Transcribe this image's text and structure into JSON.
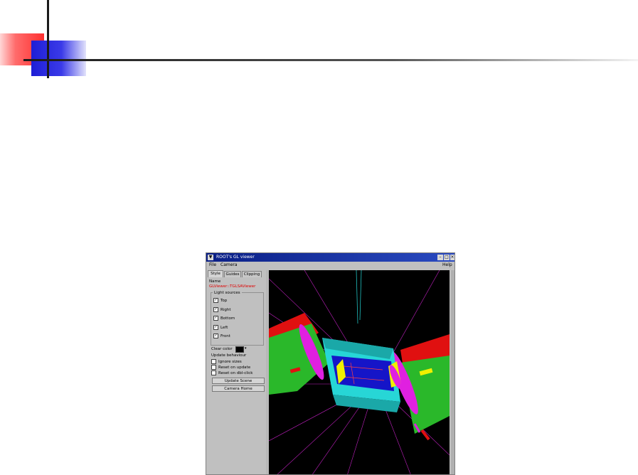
{
  "window": {
    "title": "ROOT's GL viewer",
    "menu": [
      "File",
      "Camera",
      "Help"
    ]
  },
  "panel": {
    "tabs": [
      "Style",
      "Guides",
      "Clipping"
    ],
    "name_label": "Name",
    "name_value": "GLViewer::TGLSAViewer",
    "light_sources_title": "Light sources",
    "lights": [
      {
        "label": "Top",
        "checked": true
      },
      {
        "label": "Right",
        "checked": true
      },
      {
        "label": "Bottom",
        "checked": true
      },
      {
        "label": "Left",
        "checked": true
      },
      {
        "label": "Front",
        "checked": true
      }
    ],
    "clear_color_label": "Clear color",
    "update_title": "Update behaviour",
    "update_options": [
      {
        "label": "Ignore sizes",
        "checked": false
      },
      {
        "label": "Reset on update",
        "checked": false
      },
      {
        "label": "Reset on dbl-click",
        "checked": false
      }
    ],
    "buttons": [
      "Update Scene",
      "Camera Home"
    ]
  },
  "colors": {
    "background": "#000000",
    "name_value": "#e00000",
    "detector_red": "#e01010",
    "detector_green": "#2ab82a",
    "detector_cyan": "#27d6d6",
    "detector_blue": "#1515c8",
    "detector_magenta": "#e020e0",
    "detector_yellow": "#f0f000"
  }
}
